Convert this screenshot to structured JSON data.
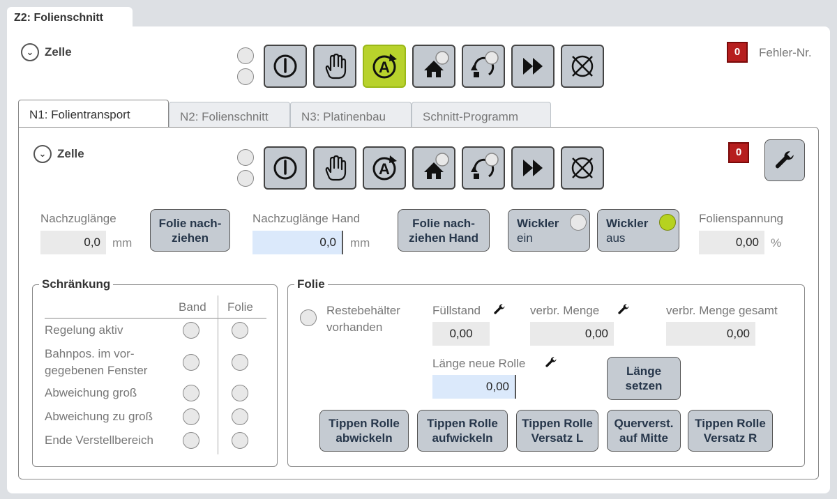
{
  "outer_tab": {
    "label": "Z2: Folienschnitt"
  },
  "cell_top": {
    "title": "Zelle",
    "error_count": "0",
    "error_label": "Fehler-Nr."
  },
  "inner_tabs": [
    {
      "label": "N1: Folientransport"
    },
    {
      "label": "N2: Folienschnitt"
    },
    {
      "label": "N3: Platinenbau"
    },
    {
      "label": "Schnitt-Programm"
    }
  ],
  "cell_inner": {
    "title": "Zelle",
    "error_count": "0"
  },
  "controls": {
    "nachzug_label": "Nachzuglänge",
    "nachzug_value": "0,0",
    "nachzug_unit": "mm",
    "folie_nach_line1": "Folie nach-",
    "folie_nach_line2": "ziehen",
    "nachzug_hand_label": "Nachzuglänge Hand",
    "nachzug_hand_value": "0,0",
    "nachzug_hand_unit": "mm",
    "folie_hand_line1": "Folie nach-",
    "folie_hand_line2": "ziehen Hand",
    "wickler_ein_line1": "Wickler",
    "wickler_ein_line2": "ein",
    "wickler_aus_line1": "Wickler",
    "wickler_aus_line2": "aus",
    "spannung_label": "Folienspannung",
    "spannung_value": "0,00",
    "spannung_unit": "%"
  },
  "schraenkung": {
    "title": "Schränkung",
    "col_band": "Band",
    "col_folie": "Folie",
    "rows": [
      {
        "line1": "Regelung aktiv",
        "line2": ""
      },
      {
        "line1": "Bahnpos. im vor-",
        "line2": "gegebenen Fenster"
      },
      {
        "line1": "Abweichung groß",
        "line2": ""
      },
      {
        "line1": "Abweichung zu groß",
        "line2": ""
      },
      {
        "line1": "Ende Verstellbereich",
        "line2": ""
      }
    ]
  },
  "folie": {
    "title": "Folie",
    "reste_line1": "Restebehälter",
    "reste_line2": "vorhanden",
    "fuellstand_label": "Füllstand",
    "fuellstand_value": "0,00",
    "verbr_label": "verbr. Menge",
    "verbr_value": "0,00",
    "verbr_gesamt_label": "verbr. Menge gesamt",
    "verbr_gesamt_value": "0,00",
    "laenge_label": "Länge neue Rolle",
    "laenge_value": "0,00",
    "laenge_btn_line1": "Länge",
    "laenge_btn_line2": "setzen",
    "buttons": [
      {
        "line1": "Tippen Rolle",
        "line2": "abwickeln"
      },
      {
        "line1": "Tippen Rolle",
        "line2": "aufwickeln"
      },
      {
        "line1": "Tippen Rolle",
        "line2": "Versatz L"
      },
      {
        "line1": "Querverst.",
        "line2": "auf Mitte"
      },
      {
        "line1": "Tippen Rolle",
        "line2": "Versatz R"
      }
    ]
  },
  "colors": {
    "active_green": "#b6d21f",
    "error_red": "#b61e1e",
    "button_gray": "#c5cbd2",
    "edit_blue": "#dbe9fb"
  }
}
